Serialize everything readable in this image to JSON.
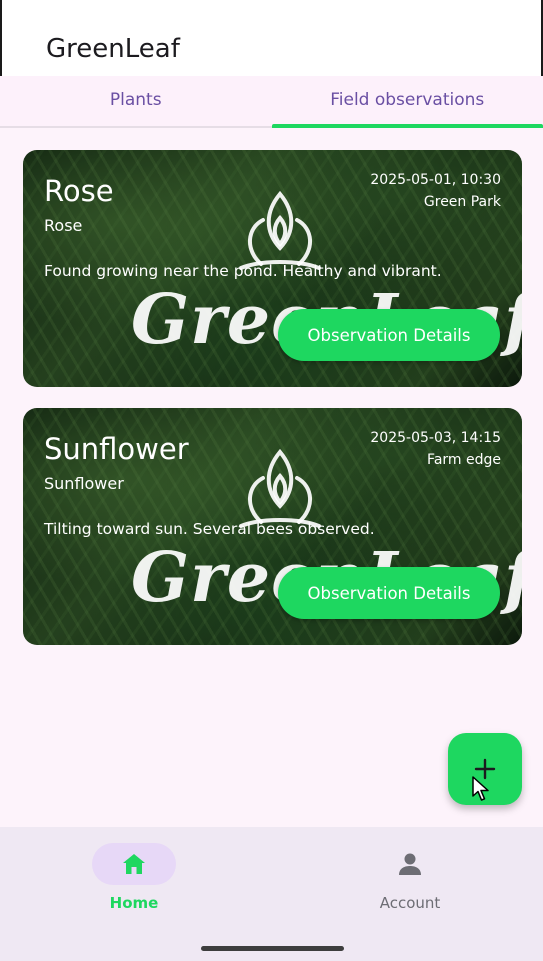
{
  "app": {
    "title": "GreenLeaf"
  },
  "tabs": [
    {
      "label": "Plants",
      "active": false
    },
    {
      "label": "Field observations",
      "active": true
    }
  ],
  "observations": [
    {
      "title": "Rose",
      "subtitle": "Rose",
      "datetime": "2025-05-01, 10:30",
      "location": "Green Park",
      "notes": "Found growing near the pond. Healthy and vibrant.",
      "button_label": "Observation Details",
      "background_wordmark": "GreenLeaf"
    },
    {
      "title": "Sunflower",
      "subtitle": "Sunflower",
      "datetime": "2025-05-03, 14:15",
      "location": "Farm edge",
      "notes": "Tilting toward sun. Several bees observed.",
      "button_label": "Observation Details",
      "background_wordmark": "GreenLeaf"
    }
  ],
  "fab": {
    "icon": "plus-icon"
  },
  "bottom_nav": [
    {
      "label": "Home",
      "icon": "home-icon",
      "active": true
    },
    {
      "label": "Account",
      "icon": "person-icon",
      "active": false
    }
  ],
  "colors": {
    "accent": "#1ed760",
    "tab_text": "#6a4fa3",
    "background": "#fdf3fb",
    "nav_background": "#efe8f3",
    "nav_pill": "#e7d8f7"
  }
}
